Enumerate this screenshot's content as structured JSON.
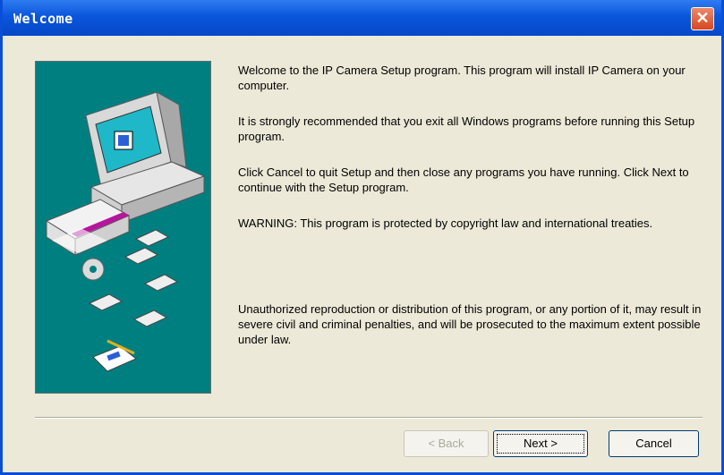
{
  "window": {
    "title": "Welcome",
    "close_icon": "close-icon"
  },
  "messages": [
    "Welcome to the IP Camera Setup program. This program will install IP Camera on your computer.",
    "It is strongly recommended that you exit all Windows programs before running this Setup program.",
    "Click Cancel to quit Setup and then close any programs you have running. Click Next to continue with the Setup program.",
    "WARNING: This program is protected by copyright law and international treaties.",
    "Unauthorized reproduction or distribution of this program, or any portion of it, may result in severe civil and criminal penalties, and will be prosecuted to the maximum extent possible under law."
  ],
  "buttons": {
    "back": "< Back",
    "next": "Next >",
    "cancel": "Cancel"
  },
  "colors": {
    "titlebar": "#0a56dc",
    "art_background": "#007f80",
    "dialog": "#ece9d8"
  }
}
